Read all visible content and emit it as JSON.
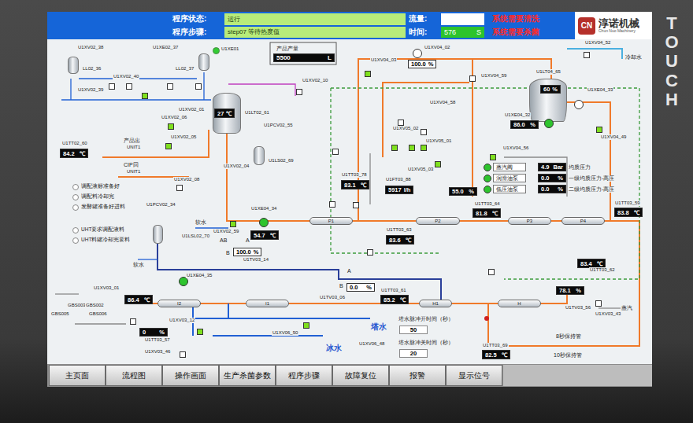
{
  "bezel": {
    "brand": "TOUCH"
  },
  "header": {
    "status_label": "程序状态:",
    "status_value": "运行",
    "step_label": "程序步骤:",
    "step_value": "step07 等待热度值",
    "flow_label": "流量:",
    "flow_value": "",
    "time_label": "时间:",
    "time_value": "576",
    "time_unit": "S",
    "alarms": [
      "系统需要清洗",
      "系统需要杀菌"
    ]
  },
  "logo": {
    "mark": "CN",
    "name": "淳诺机械",
    "subtitle": "Chun Nuo Machinery"
  },
  "labels": [
    {
      "text": "U1XV02_38",
      "kind": "tag"
    },
    {
      "text": "U1XE02_37",
      "kind": "tag"
    },
    {
      "text": "LL02_36",
      "kind": "tag"
    },
    {
      "text": "LL02_37",
      "kind": "tag"
    },
    {
      "text": "U1XV02_40",
      "kind": "tag"
    },
    {
      "text": "U1XV02_39",
      "kind": "tag"
    },
    {
      "text": "U1XE01",
      "kind": "tag"
    },
    {
      "text": "产品产量",
      "kind": "note"
    },
    {
      "text": "U1XV02_01",
      "kind": "tag"
    },
    {
      "text": "U1XV02_06",
      "kind": "tag"
    },
    {
      "text": "U1LT02_61",
      "kind": "tag"
    },
    {
      "text": "U1XV02_10",
      "kind": "tag"
    },
    {
      "text": "U1PCV02_55",
      "kind": "tag"
    },
    {
      "text": "U1LS02_69",
      "kind": "tag"
    },
    {
      "text": "U1TT02_60",
      "kind": "tag"
    },
    {
      "text": "产品出",
      "kind": "note"
    },
    {
      "text": "UNIT1",
      "kind": "tag"
    },
    {
      "text": "CIP回",
      "kind": "note"
    },
    {
      "text": "UNIT1",
      "kind": "tag"
    },
    {
      "text": "U1XV02_05",
      "kind": "tag"
    },
    {
      "text": "U1XV02_04",
      "kind": "tag"
    },
    {
      "text": "U1XV02_08",
      "kind": "tag"
    },
    {
      "text": "U1PCV02_34",
      "kind": "tag"
    },
    {
      "text": "U1XV02_59",
      "kind": "tag"
    },
    {
      "text": "U1XE04_34",
      "kind": "tag"
    },
    {
      "text": "软水",
      "kind": "note"
    },
    {
      "text": "U1LSL02_70",
      "kind": "tag"
    },
    {
      "text": "软水",
      "kind": "note"
    },
    {
      "text": "AB",
      "kind": "note"
    },
    {
      "text": "A",
      "kind": "note"
    },
    {
      "text": "B",
      "kind": "note"
    },
    {
      "text": "U1TV03_14",
      "kind": "tag"
    },
    {
      "text": "U1TT03_78",
      "kind": "tag"
    },
    {
      "text": "U1FT03_88",
      "kind": "tag"
    },
    {
      "text": "U1XV05_02",
      "kind": "tag"
    },
    {
      "text": "U1XV05_01",
      "kind": "tag"
    },
    {
      "text": "U1XV05_03",
      "kind": "tag"
    },
    {
      "text": "U1XV04_56",
      "kind": "tag"
    },
    {
      "text": "U1XV04_58",
      "kind": "tag"
    },
    {
      "text": "U1XV04_02",
      "kind": "tag"
    },
    {
      "text": "U1XV04_03",
      "kind": "tag"
    },
    {
      "text": "U1XV04_59",
      "kind": "tag"
    },
    {
      "text": "U1LT04_65",
      "kind": "tag"
    },
    {
      "text": "U1XV04_52",
      "kind": "tag"
    },
    {
      "text": "冷却水",
      "kind": "note"
    },
    {
      "text": "U1XE04_33",
      "kind": "tag"
    },
    {
      "text": "U1XE04_32",
      "kind": "tag"
    },
    {
      "text": "U1XV04_49",
      "kind": "tag"
    },
    {
      "text": "均质压力",
      "kind": "note"
    },
    {
      "text": "一级均质压力-高压",
      "kind": "note"
    },
    {
      "text": "二级均质压力-高压",
      "kind": "note"
    },
    {
      "text": "U1TT03_63",
      "kind": "tag"
    },
    {
      "text": "U1TT03_64",
      "kind": "tag"
    },
    {
      "text": "U1TT03_59",
      "kind": "tag"
    },
    {
      "text": "U1TT03_62",
      "kind": "tag"
    },
    {
      "text": "U1XE04_35",
      "kind": "tag"
    },
    {
      "text": "U1XV03_01",
      "kind": "tag"
    },
    {
      "text": "U1XV03_12",
      "kind": "tag"
    },
    {
      "text": "U1TT03_57",
      "kind": "tag"
    },
    {
      "text": "U1XV03_46",
      "kind": "tag"
    },
    {
      "text": "A",
      "kind": "note"
    },
    {
      "text": "B",
      "kind": "note"
    },
    {
      "text": "U1TV03_06",
      "kind": "tag"
    },
    {
      "text": "U1TT03_61",
      "kind": "tag"
    },
    {
      "text": "塔水",
      "kind": "water"
    },
    {
      "text": "冰水",
      "kind": "water"
    },
    {
      "text": "U1XV06_50",
      "kind": "tag"
    },
    {
      "text": "U1XV06_48",
      "kind": "tag"
    },
    {
      "text": "塔水脉冲开时间（秒）",
      "kind": "note"
    },
    {
      "text": "塔水脉冲关时间（秒）",
      "kind": "note"
    },
    {
      "text": "U1TV03_56",
      "kind": "tag"
    },
    {
      "text": "U1XV03_43",
      "kind": "tag"
    },
    {
      "text": "蒸汽",
      "kind": "note"
    },
    {
      "text": "U1TT03_69",
      "kind": "tag"
    },
    {
      "text": "8秒保持管",
      "kind": "note"
    },
    {
      "text": "10秒保持管",
      "kind": "note"
    },
    {
      "text": "GBS003",
      "kind": "tag"
    },
    {
      "text": "GBS002",
      "kind": "tag"
    },
    {
      "text": "GBS005",
      "kind": "tag"
    },
    {
      "text": "GBS006",
      "kind": "tag"
    }
  ],
  "legend": [
    {
      "text": "调配液标准备好",
      "on": false
    },
    {
      "text": "调配料冷却完",
      "on": false
    },
    {
      "text": "发酵罐准备好进料",
      "on": false
    },
    {
      "text": "UHT要求调配液料",
      "on": false
    },
    {
      "text": "UHT料罐冷却完要料",
      "on": false
    }
  ],
  "readings": [
    {
      "value": "5500",
      "unit": "L",
      "kind": "total"
    },
    {
      "value": "27",
      "unit": "℃",
      "kind": "tank"
    },
    {
      "value": "84.2",
      "unit": "℃",
      "kind": "dark"
    },
    {
      "value": "54.7",
      "unit": "℃",
      "kind": "dark"
    },
    {
      "value": "100.0",
      "unit": "%",
      "kind": "light"
    },
    {
      "value": "83.1",
      "unit": "℃",
      "kind": "dark"
    },
    {
      "value": "5917",
      "unit": "l/h",
      "kind": "dark"
    },
    {
      "value": "55.0",
      "unit": "%",
      "kind": "dark"
    },
    {
      "value": "100.0",
      "unit": "%",
      "kind": "light"
    },
    {
      "value": "60",
      "unit": "%",
      "kind": "tank"
    },
    {
      "value": "86.0",
      "unit": "%",
      "kind": "dark"
    },
    {
      "value": "4.9",
      "unit": "Bar",
      "kind": "dark"
    },
    {
      "value": "0.0",
      "unit": "%",
      "kind": "dark"
    },
    {
      "value": "0.0",
      "unit": "%",
      "kind": "dark"
    },
    {
      "value": "83.6",
      "unit": "℃",
      "kind": "dark"
    },
    {
      "value": "81.8",
      "unit": "℃",
      "kind": "dark"
    },
    {
      "value": "83.8",
      "unit": "℃",
      "kind": "dark"
    },
    {
      "value": "83.4",
      "unit": "℃",
      "kind": "dark"
    },
    {
      "value": "86.4",
      "unit": "℃",
      "kind": "dark"
    },
    {
      "value": "0",
      "unit": "%",
      "kind": "dark"
    },
    {
      "value": "0.0",
      "unit": "%",
      "kind": "light"
    },
    {
      "value": "85.2",
      "unit": "℃",
      "kind": "dark"
    },
    {
      "value": "78.1",
      "unit": "%",
      "kind": "dark"
    },
    {
      "value": "82.5",
      "unit": "℃",
      "kind": "dark"
    },
    {
      "value": "50",
      "unit": "",
      "kind": "input"
    },
    {
      "value": "20",
      "unit": "",
      "kind": "input"
    }
  ],
  "exchangers": [
    {
      "name": "P1"
    },
    {
      "name": "P2"
    },
    {
      "name": "P3"
    },
    {
      "name": "P4"
    },
    {
      "name": "I2"
    },
    {
      "name": "I1"
    },
    {
      "name": "H1"
    },
    {
      "name": "H"
    }
  ],
  "valves": [
    {
      "open": false
    },
    {
      "open": false
    },
    {
      "open": false
    },
    {
      "open": false
    },
    {
      "open": true
    },
    {
      "open": true
    },
    {
      "open": true
    },
    {
      "open": false
    },
    {
      "open": true
    },
    {
      "open": false
    },
    {
      "open": false
    },
    {
      "open": true
    },
    {
      "open": true
    },
    {
      "open": true
    },
    {
      "open": true
    },
    {
      "open": true
    },
    {
      "open": true
    },
    {
      "open": false
    },
    {
      "open": true
    },
    {
      "open": true
    },
    {
      "open": true
    },
    {
      "open": false
    },
    {
      "open": false
    },
    {
      "open": false
    },
    {
      "open": false
    },
    {
      "open": false
    },
    {
      "open": false
    },
    {
      "open": false
    },
    {
      "open": false
    },
    {
      "open": false
    },
    {
      "open": false
    }
  ],
  "pumps": [
    {
      "running": true
    },
    {
      "running": true
    },
    {
      "running": true
    },
    {
      "running": false
    },
    {
      "running": false
    }
  ],
  "indicators": [
    {
      "on": true
    }
  ],
  "motors": [
    {
      "label": "蒸汽阀",
      "on": true
    },
    {
      "label": "润滑油泵",
      "on": true
    },
    {
      "label": "低压油泵",
      "on": true
    }
  ],
  "footer": {
    "buttons": [
      {
        "label": "主页面"
      },
      {
        "label": "流程图"
      },
      {
        "label": "操作画面"
      },
      {
        "label": "生产杀菌参数"
      },
      {
        "label": "程序步骤"
      },
      {
        "label": "故障复位"
      },
      {
        "label": "报警"
      },
      {
        "label": "显示位号"
      }
    ]
  }
}
